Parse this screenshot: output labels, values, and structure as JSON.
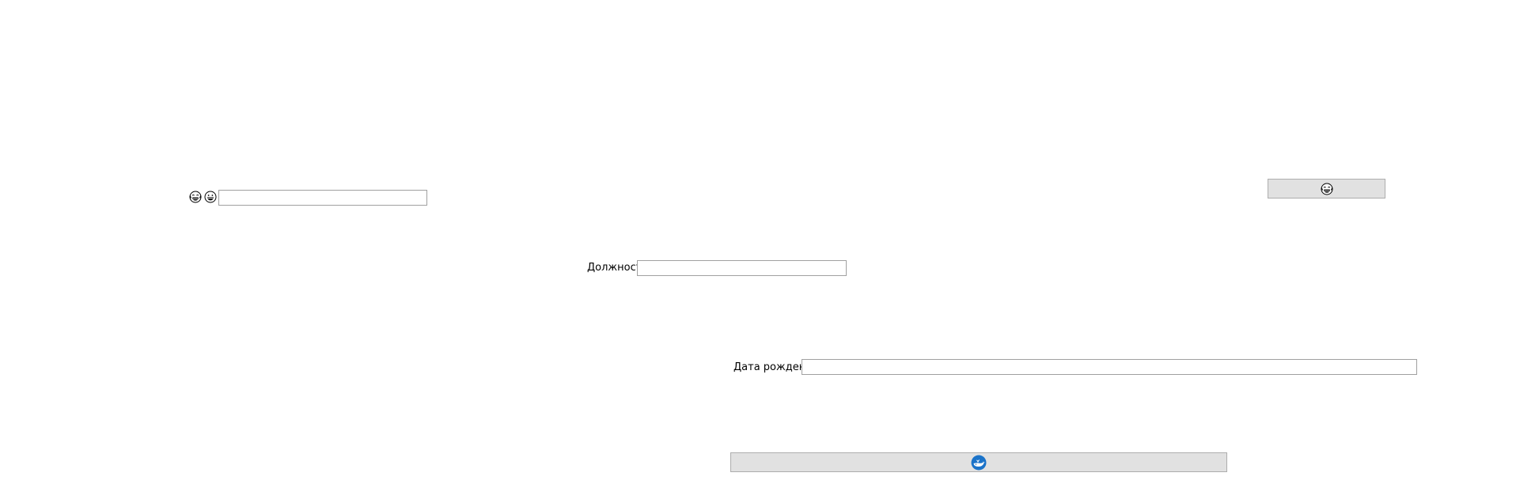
{
  "form": {
    "field1": {
      "label_icons": [
        "laughing-face-icon",
        "grinning-face-icon"
      ],
      "value": ""
    },
    "position": {
      "label": "Должность",
      "value": ""
    },
    "birth_date": {
      "label": "Дата рождения",
      "value": ""
    },
    "top_button": {
      "icon": "laughing-face-icon"
    },
    "bottom_button": {
      "icon": "whale-icon",
      "icon_color": "#1b73c9"
    }
  }
}
